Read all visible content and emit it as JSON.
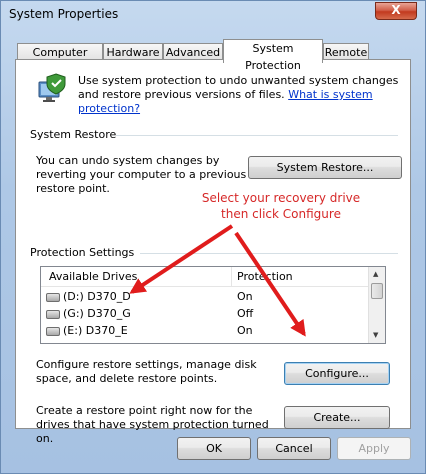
{
  "window": {
    "title": "System Properties",
    "close_label": "X"
  },
  "tabs": [
    {
      "label": "Computer Name"
    },
    {
      "label": "Hardware"
    },
    {
      "label": "Advanced"
    },
    {
      "label": "System Protection"
    },
    {
      "label": "Remote"
    }
  ],
  "intro": {
    "text": "Use system protection to undo unwanted system changes and restore previous versions of files.",
    "link": "What is system protection?"
  },
  "system_restore": {
    "heading": "System Restore",
    "text": "You can undo system changes by reverting your computer to a previous restore point.",
    "button": "System Restore..."
  },
  "protection": {
    "heading": "Protection Settings",
    "columns": {
      "drives": "Available Drives",
      "protection": "Protection"
    },
    "rows": [
      {
        "drive": "(D:) D370_D",
        "protection": "On"
      },
      {
        "drive": "(G:) D370_G",
        "protection": "Off"
      },
      {
        "drive": "(E:) D370_E",
        "protection": "On"
      }
    ],
    "configure_text": "Configure restore settings, manage disk space, and delete restore points.",
    "configure_button": "Configure...",
    "create_text": "Create a restore point right now for the drives that have system protection turned on.",
    "create_button": "Create..."
  },
  "annotation": {
    "line1": "Select your recovery drive",
    "line2": "then click Configure",
    "color": "#d62828"
  },
  "footer": {
    "ok": "OK",
    "cancel": "Cancel",
    "apply": "Apply"
  }
}
